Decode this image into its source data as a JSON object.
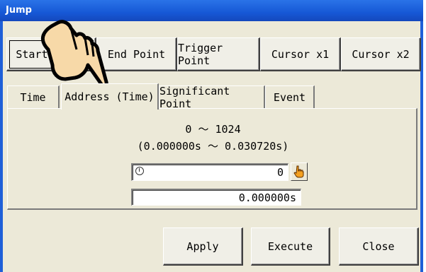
{
  "window": {
    "title": "Jump"
  },
  "point_buttons": [
    {
      "label": "Start Point"
    },
    {
      "label": "End Point"
    },
    {
      "label": "Trigger Point"
    },
    {
      "label": "Cursor x1"
    },
    {
      "label": "Cursor x2"
    }
  ],
  "tabs": [
    {
      "label": "Time",
      "active": false
    },
    {
      "label": "Address (Time)",
      "active": true
    },
    {
      "label": "Significant Point",
      "active": false
    },
    {
      "label": "Event",
      "active": false
    }
  ],
  "panel": {
    "range_line1": "0 ～ 1024",
    "range_line2": "(0.000000s ～ 0.030720s)",
    "address_value": "0",
    "time_value": "0.000000s"
  },
  "actions": {
    "apply": "Apply",
    "execute": "Execute",
    "close": "Close"
  },
  "icons": {
    "address_knob": "dial-icon",
    "pointer_button": "hand-pointer-icon",
    "overlay": "pointing-hand-cursor"
  },
  "colors": {
    "titlebar": "#1658d6",
    "face": "#ece9d8",
    "hand_fill": "#f7d9a8"
  }
}
